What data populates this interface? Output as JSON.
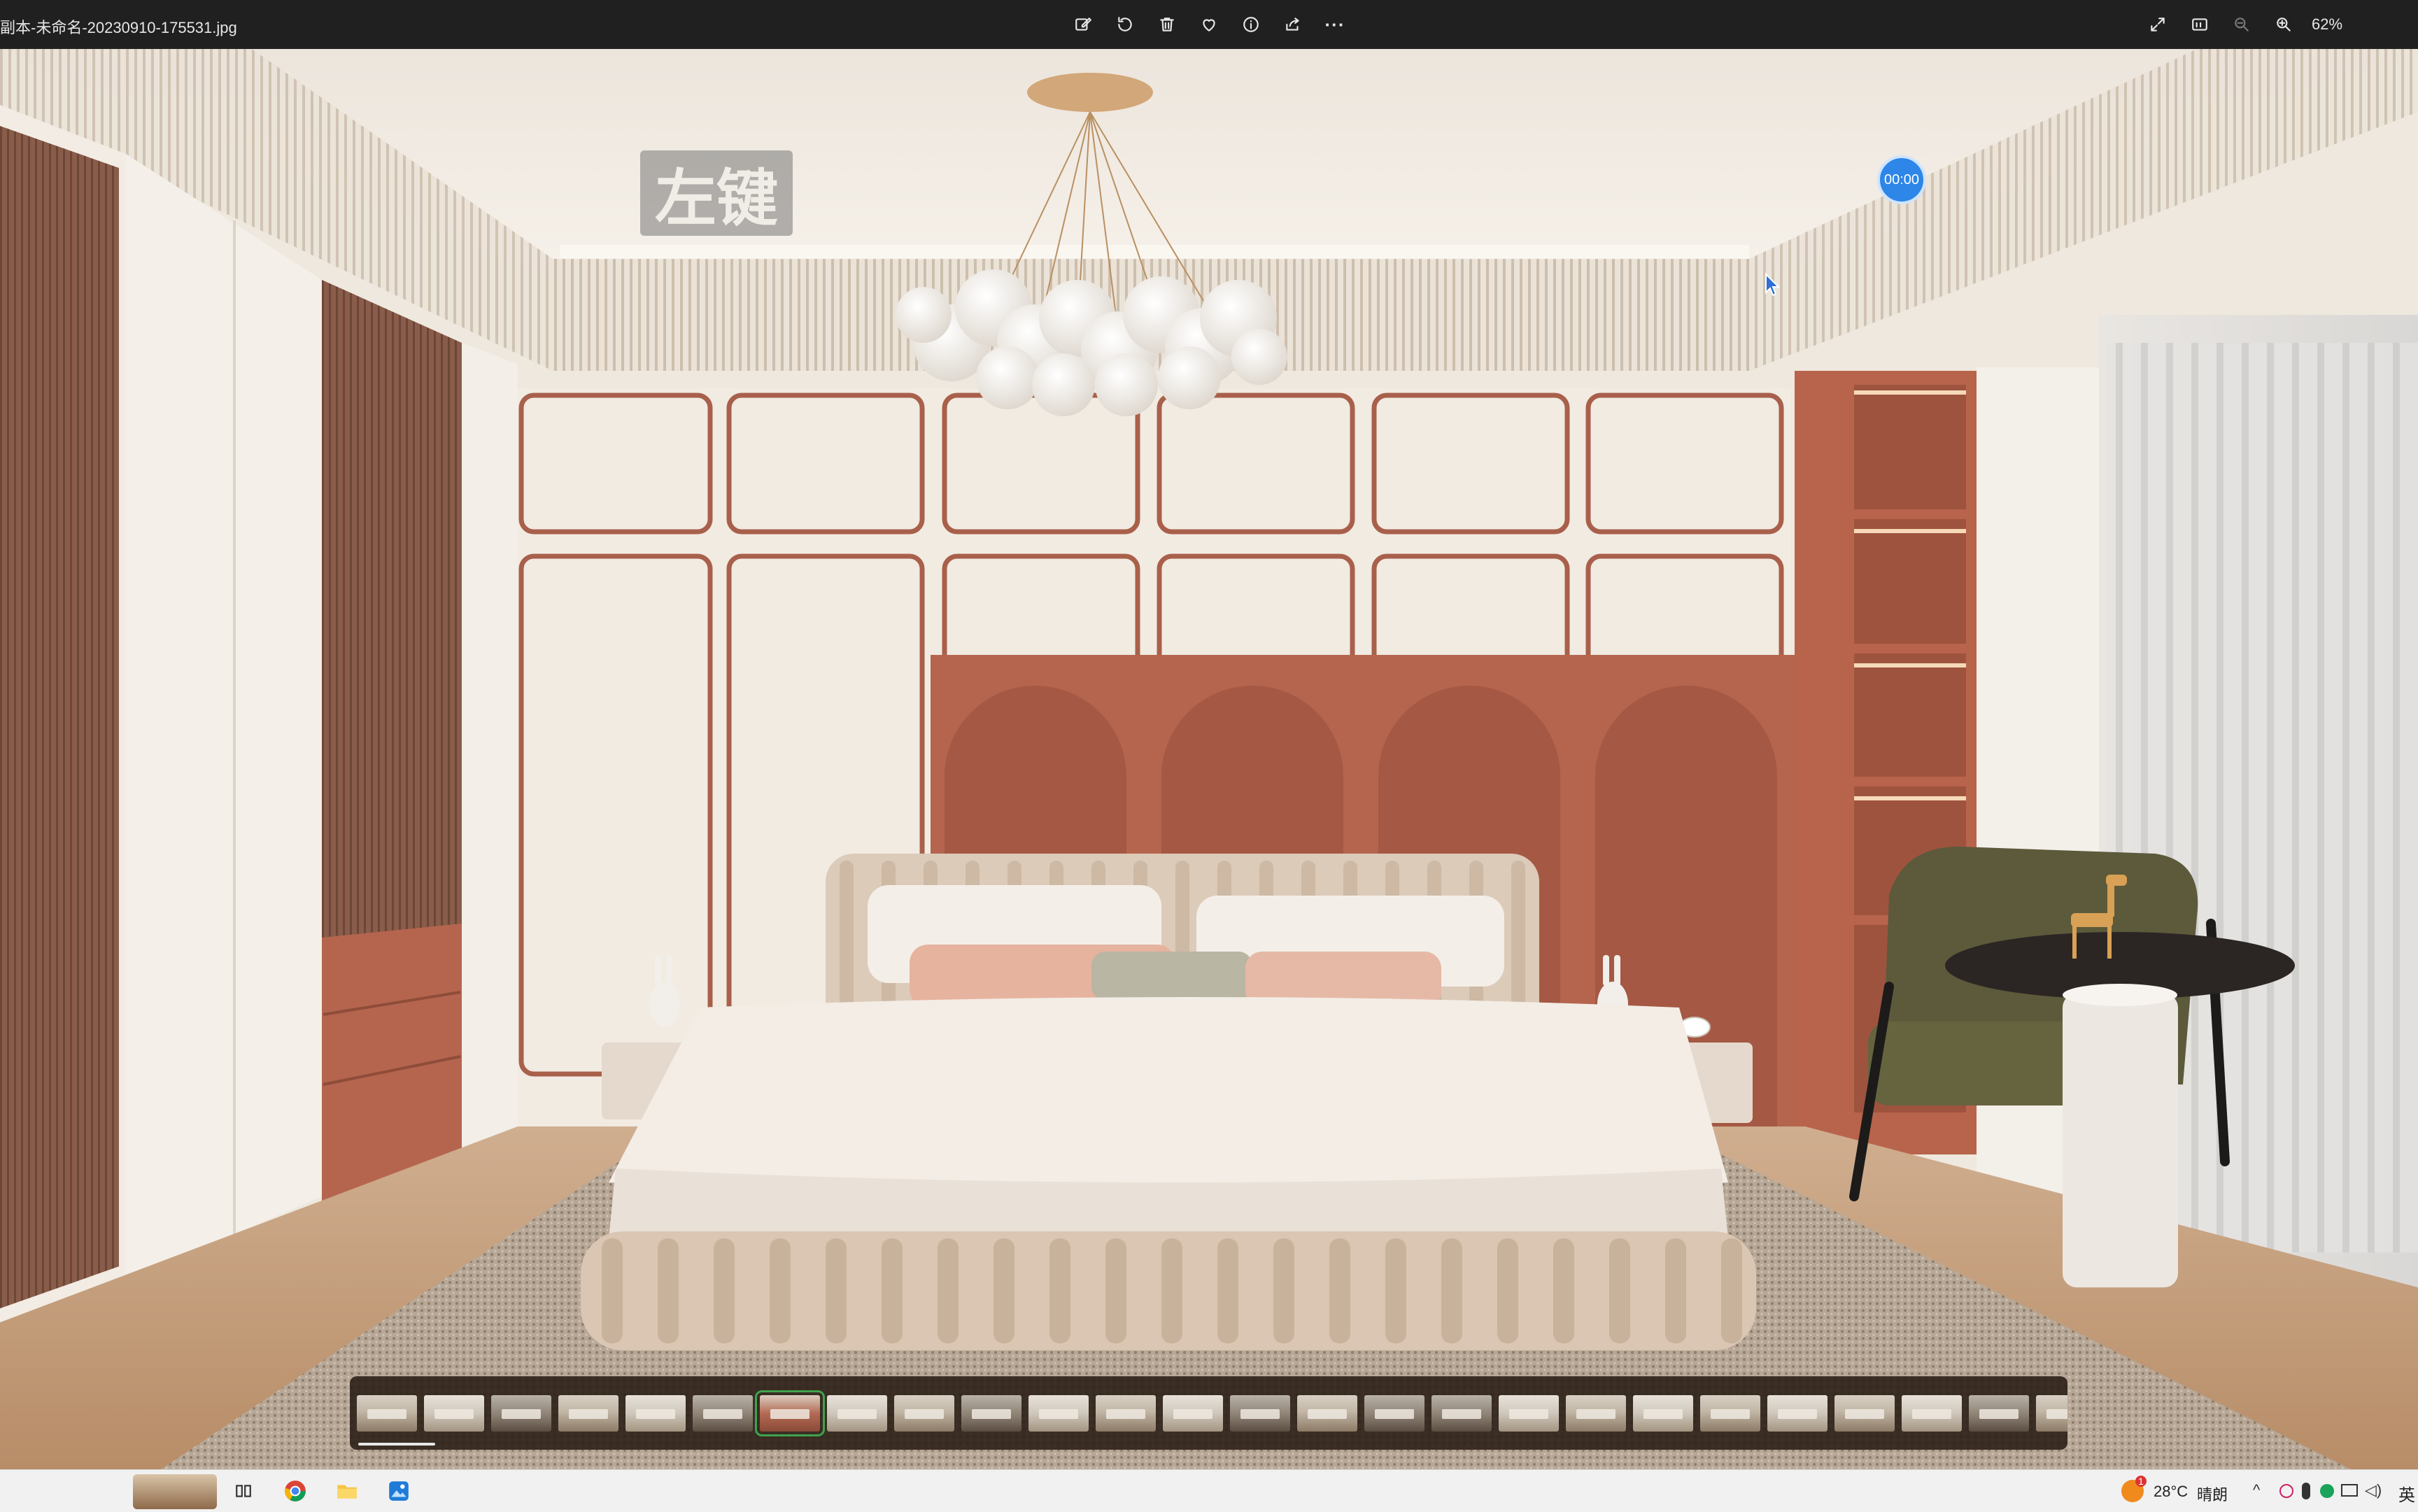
{
  "title_bar": {
    "filename": "副本-未命名-20230910-175531.jpg",
    "actions": [
      "edit-icon",
      "rotate-icon",
      "delete-icon",
      "favorite-icon",
      "info-icon",
      "share-icon",
      "more-icon"
    ],
    "more_label": "···",
    "zoom_level": "62%"
  },
  "overlay": {
    "watermark_text": "左键",
    "timer_text": "00:00"
  },
  "filmstrip": {
    "thumbnail_count": 26,
    "active_index": 6
  },
  "taskbar": {
    "apps": [
      "photo-thumbnail",
      "task-view-icon",
      "chrome-icon",
      "file-explorer-icon",
      "photos-app-icon"
    ],
    "weather_temp": "28°C",
    "weather_desc": "晴朗",
    "input_language": "英",
    "notification_badge": "1"
  },
  "colors": {
    "accent_terracotta": "#b5654e",
    "wall_cream": "#efe7dc",
    "timer_blue": "#2e86e8",
    "active_thumb_border": "#3fa34d"
  }
}
